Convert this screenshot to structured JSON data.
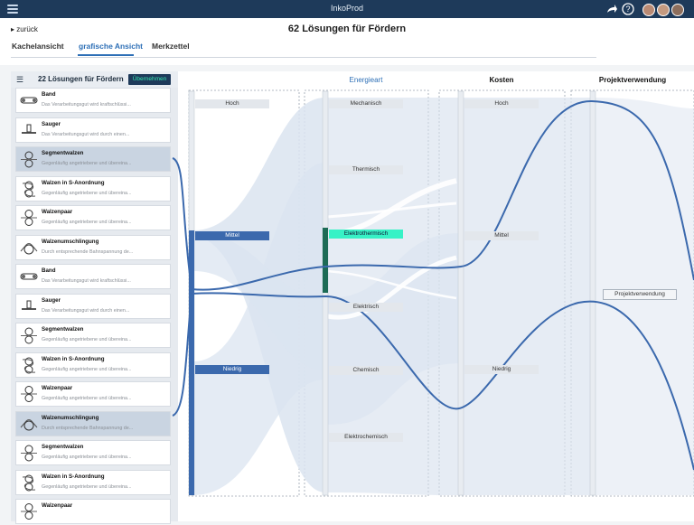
{
  "app": {
    "title": "InkoProd"
  },
  "nav": {
    "back_label": "zurück",
    "page_title": "62 Lösungen für Fördern"
  },
  "tabs": [
    {
      "label": "Kachelansicht",
      "active": false
    },
    {
      "label": "grafische Ansicht",
      "active": true
    },
    {
      "label": "Merkzettel",
      "active": false
    }
  ],
  "panel": {
    "heading": "22 Lösungen für Fördern",
    "apply_label": "Übernehmen"
  },
  "cards": [
    {
      "title": "Band",
      "desc": "Das Verarbeitungsgut wird kraftschlüssi...",
      "icon": "band-icon",
      "selected": false
    },
    {
      "title": "Sauger",
      "desc": "Das Verarbeitungsgut wird durch einen...",
      "icon": "sauger-icon",
      "selected": false
    },
    {
      "title": "Segmentwalzen",
      "desc": "Gegenläufig angetriebene und übereina...",
      "icon": "segmentwalzen-icon",
      "selected": true
    },
    {
      "title": "Walzen in S-Anordnung",
      "desc": "Gegenläufig angetriebene und übereina...",
      "icon": "s-walzen-icon",
      "selected": false
    },
    {
      "title": "Walzenpaar",
      "desc": "Gegenläufig angetriebene und übereina...",
      "icon": "walzenpaar-icon",
      "selected": false
    },
    {
      "title": "Walzenumschlingung",
      "desc": "Durch entsprechende Bahnspannung de...",
      "icon": "umschlingung-icon",
      "selected": false
    },
    {
      "title": "Band",
      "desc": "Das Verarbeitungsgut wird kraftschlüssi...",
      "icon": "band-icon",
      "selected": false
    },
    {
      "title": "Sauger",
      "desc": "Das Verarbeitungsgut wird durch einen...",
      "icon": "sauger-icon",
      "selected": false
    },
    {
      "title": "Segmentwalzen",
      "desc": "Gegenläufig angetriebene und übereina...",
      "icon": "segmentwalzen-icon",
      "selected": false
    },
    {
      "title": "Walzen in S-Anordnung",
      "desc": "Gegenläufig angetriebene und übereina...",
      "icon": "s-walzen-icon",
      "selected": false
    },
    {
      "title": "Walzenpaar",
      "desc": "Gegenläufig angetriebene und übereina...",
      "icon": "walzenpaar-icon",
      "selected": false
    },
    {
      "title": "Walzenumschlingung",
      "desc": "Durch entsprechende Bahnspannung de...",
      "icon": "umschlingung-icon",
      "selected": true
    },
    {
      "title": "Segmentwalzen",
      "desc": "Gegenläufig angetriebene und übereina...",
      "icon": "segmentwalzen-icon",
      "selected": false
    },
    {
      "title": "Walzen in S-Anordnung",
      "desc": "Gegenläufig angetriebene und übereina...",
      "icon": "s-walzen-icon",
      "selected": false
    },
    {
      "title": "Walzenpaar",
      "desc": "",
      "icon": "walzenpaar-icon",
      "selected": false
    }
  ],
  "graph": {
    "columns": {
      "energieart": "Energieart",
      "kosten": "Kosten",
      "projekt": "Projektverwendung"
    },
    "first_axis": {
      "hoch": "Hoch",
      "mittel": "Mittel",
      "niedrig": "Niedrig"
    },
    "energie": {
      "mechanisch": "Mechanisch",
      "thermisch": "Thermisch",
      "elektrothermisch": "Elektrothermisch",
      "elektrisch": "Elektrisch",
      "chemisch": "Chemisch",
      "elektrochemisch": "Elektrochemisch"
    },
    "kosten": {
      "hoch": "Hoch",
      "mittel": "Mittel",
      "niedrig": "Niedrig"
    },
    "projekt": {
      "projektverwendung": "Projektverwendung"
    }
  },
  "colors": {
    "header": "#1e3a5a",
    "accent": "#2d6fb6",
    "highlight": "#37f2c6",
    "flow": "#dbe4f0",
    "selected_bar": "#1d6b55"
  }
}
